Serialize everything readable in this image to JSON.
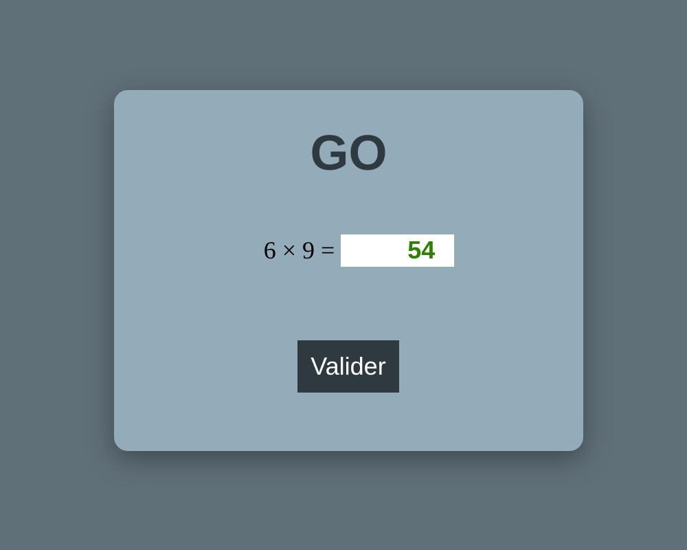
{
  "game": {
    "status_title": "GO",
    "equation": "6 × 9 =",
    "answer_value": "54",
    "validate_label": "Valider"
  },
  "colors": {
    "background": "#607079",
    "card": "#94acb9",
    "title": "#2e3a40",
    "answer_text": "#2e8000",
    "button": "#2f3a40"
  }
}
